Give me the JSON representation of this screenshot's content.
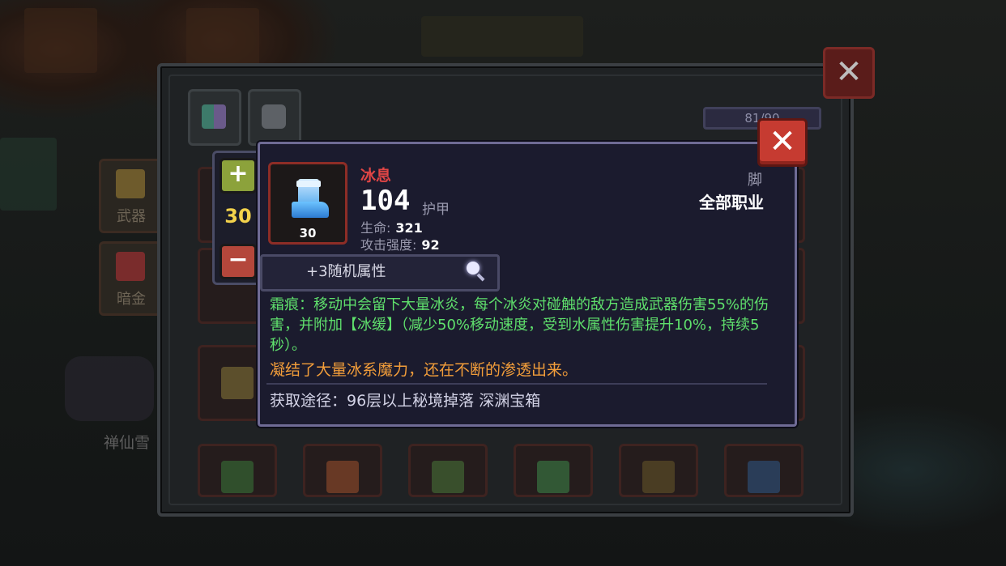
{
  "background": {
    "left_tiles": [
      {
        "label": "武器"
      },
      {
        "label": "暗金"
      }
    ],
    "npc_name": "禅仙雪"
  },
  "inventory": {
    "capacity_text": "81/90",
    "close_icon": "close-icon"
  },
  "stepper": {
    "plus_symbol": "+",
    "minus_symbol": "−",
    "count": "30"
  },
  "item": {
    "name": "冰息",
    "level": "30",
    "armor_value": "104",
    "armor_label": "护甲",
    "stats": [
      {
        "label": "生命:",
        "value": "321"
      },
      {
        "label": "攻击强度:",
        "value": "92"
      }
    ],
    "slot_type": "脚",
    "class_requirement": "全部职业",
    "random_attributes": "+3随机属性",
    "description": "霜痕：移动中会留下大量冰炎，每个冰炎对碰触的敌方造成武器伤害55%的伤害，并附加【冰缓】（减少50%移动速度，受到水属性伤害提升10%，持续5秒）。",
    "flavor_text": "凝结了大量冰系魔力，还在不断的渗透出来。",
    "source": "获取途径：96层以上秘境掉落 深渊宝箱",
    "colors": {
      "name": "#e04545",
      "description": "#5fe06c",
      "flavor": "#f29d3a"
    }
  },
  "close_symbol": "✕"
}
